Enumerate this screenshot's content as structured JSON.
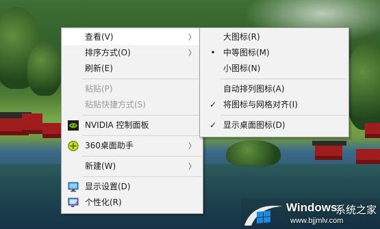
{
  "main_menu": {
    "items": [
      {
        "label": "查看(V)",
        "submenu": true
      },
      {
        "label": "排序方式(O)",
        "submenu": true
      },
      {
        "label": "刷新(E)"
      },
      {
        "label": "粘贴(P)",
        "disabled": true
      },
      {
        "label": "粘贴快捷方式(S)",
        "disabled": true
      },
      {
        "label": "NVIDIA 控制面板",
        "icon": "nvidia-icon"
      },
      {
        "label": "360桌面助手",
        "icon": "360-assistant-icon",
        "submenu": true
      },
      {
        "label": "新建(W)",
        "submenu": true
      },
      {
        "label": "显示设置(D)",
        "icon": "display-settings-icon"
      },
      {
        "label": "个性化(R)",
        "icon": "personalize-icon"
      }
    ]
  },
  "view_submenu": {
    "items": [
      {
        "label": "大图标(R)"
      },
      {
        "label": "中等图标(M)",
        "mark": "•"
      },
      {
        "label": "小图标(N)"
      },
      {
        "label": "自动排列图标(A)"
      },
      {
        "label": "将图标与网格对齐(I)",
        "mark": "✓"
      },
      {
        "label": "显示桌面图标(D)",
        "mark": "✓"
      }
    ]
  },
  "watermark": {
    "brand": "Windows",
    "brand_cn": "系统之家",
    "site": "www.bjjmlv.com"
  },
  "colors": {
    "menu_bg": "#f2f2f2",
    "hover_bg": "#ffffff",
    "disabled_text": "#9a9a9a",
    "nvidia_green": "#76b900",
    "win_blue": "#1e88e5"
  }
}
